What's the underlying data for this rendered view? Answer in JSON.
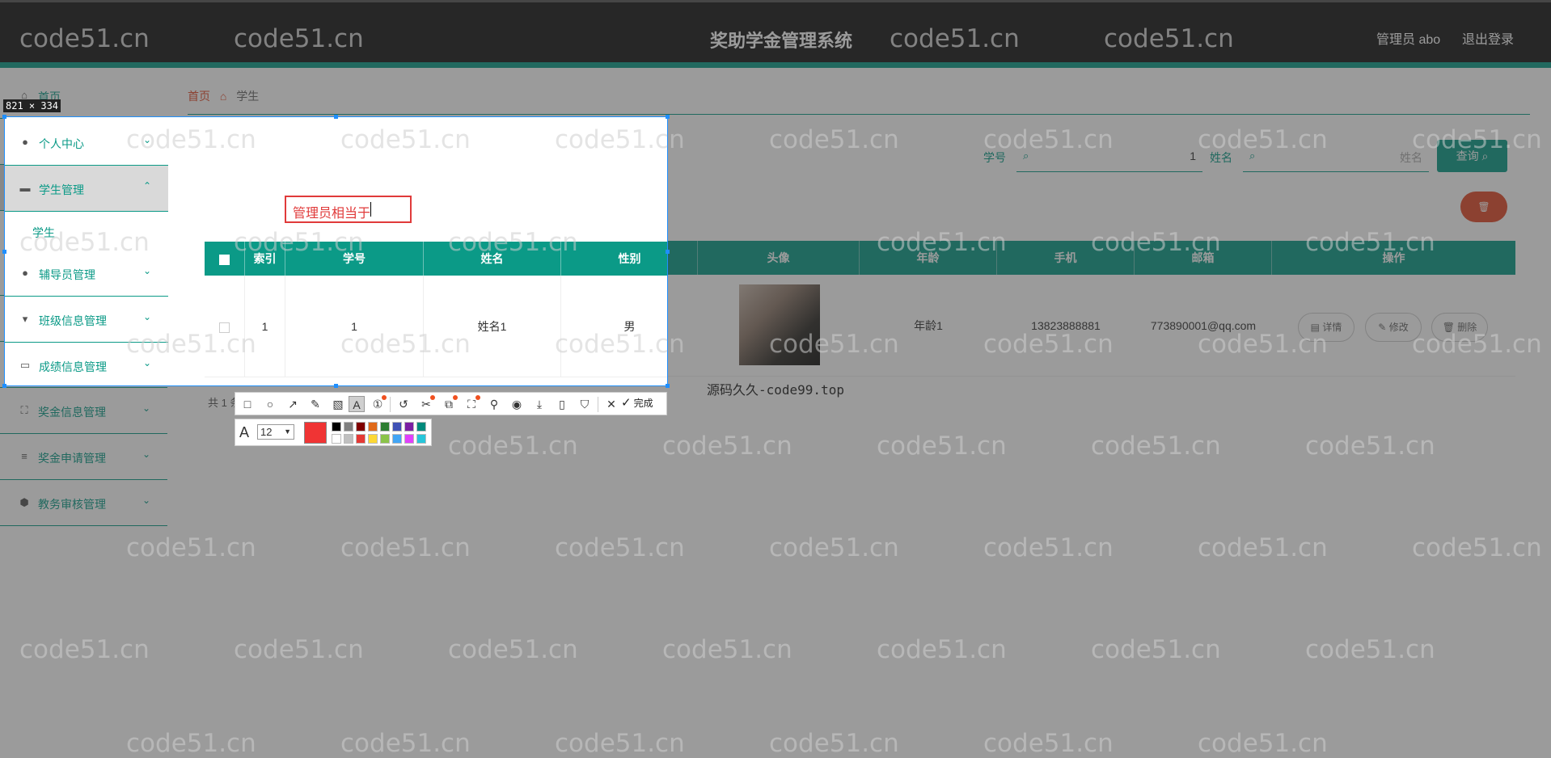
{
  "app": {
    "title": "奖助学金管理系统",
    "user": "管理员 abo",
    "logout": "退出登录"
  },
  "sidebar": {
    "items": [
      {
        "label": "首页",
        "icon": "home-icon"
      },
      {
        "label": "个人中心",
        "icon": "person-icon"
      },
      {
        "label": "学生管理",
        "icon": "briefcase-icon"
      },
      {
        "label": "辅导员管理",
        "icon": "person-icon"
      },
      {
        "label": "班级信息管理",
        "icon": "stamp-icon"
      },
      {
        "label": "成绩信息管理",
        "icon": "card-icon"
      },
      {
        "label": "奖金信息管理",
        "icon": "expand-icon"
      },
      {
        "label": "奖金申请管理",
        "icon": "list-icon"
      },
      {
        "label": "教务审核管理",
        "icon": "shield-icon"
      }
    ],
    "submenu": "学生"
  },
  "breadcrumb": {
    "home": "首页",
    "current": "学生"
  },
  "search": {
    "id_label": "学号",
    "id_value": "1",
    "name_label": "姓名",
    "name_placeholder": "姓名",
    "query_button": "查询"
  },
  "table": {
    "headers": [
      "索引",
      "学号",
      "姓名",
      "性别",
      "头像",
      "年龄",
      "手机",
      "邮箱",
      "操作"
    ],
    "rows": [
      {
        "index": "1",
        "id": "1",
        "name": "姓名1",
        "gender": "男",
        "age": "年龄1",
        "phone": "13823888881",
        "email": "773890001@qq.com"
      }
    ],
    "ops": {
      "detail": "详情",
      "edit": "修改",
      "delete": "删除"
    }
  },
  "pager": "共 1 条",
  "caption": "源码久久-code99.top",
  "watermark": "code51.cn",
  "screenshot_tool": {
    "selection_size": "821 × 334",
    "annotation_text": "管理员相当于",
    "finish_label": "完成",
    "font_size": "12",
    "current_color": "#f03434",
    "palette": [
      "#000000",
      "#808080",
      "#800000",
      "#e06a1a",
      "#2e7d32",
      "#3f51b5",
      "#7b1fa2",
      "#00897b",
      "#ffffff",
      "#c0c0c0",
      "#e53935",
      "#fdd835",
      "#8bc34a",
      "#42a5f5",
      "#e040fb",
      "#26c6da"
    ]
  },
  "colors": {
    "accent": "#0b9a87",
    "danger": "#e04a2a",
    "header": "#171717"
  }
}
